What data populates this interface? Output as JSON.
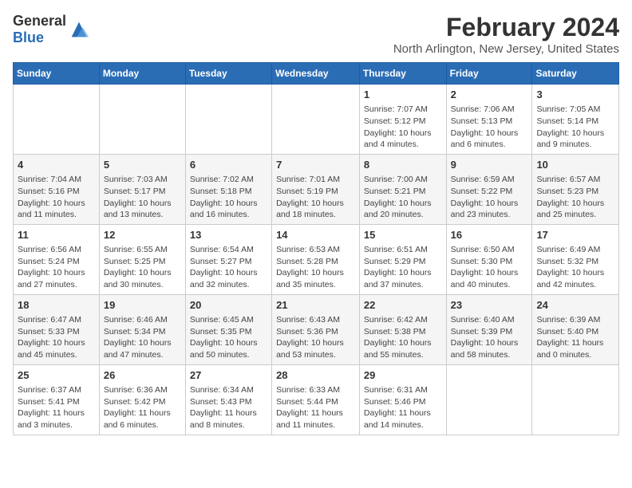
{
  "app": {
    "logo_general": "General",
    "logo_blue": "Blue"
  },
  "header": {
    "title": "February 2024",
    "subtitle": "North Arlington, New Jersey, United States"
  },
  "weekdays": [
    "Sunday",
    "Monday",
    "Tuesday",
    "Wednesday",
    "Thursday",
    "Friday",
    "Saturday"
  ],
  "weeks": [
    [
      {
        "day": "",
        "content": ""
      },
      {
        "day": "",
        "content": ""
      },
      {
        "day": "",
        "content": ""
      },
      {
        "day": "",
        "content": ""
      },
      {
        "day": "1",
        "content": "Sunrise: 7:07 AM\nSunset: 5:12 PM\nDaylight: 10 hours\nand 4 minutes."
      },
      {
        "day": "2",
        "content": "Sunrise: 7:06 AM\nSunset: 5:13 PM\nDaylight: 10 hours\nand 6 minutes."
      },
      {
        "day": "3",
        "content": "Sunrise: 7:05 AM\nSunset: 5:14 PM\nDaylight: 10 hours\nand 9 minutes."
      }
    ],
    [
      {
        "day": "4",
        "content": "Sunrise: 7:04 AM\nSunset: 5:16 PM\nDaylight: 10 hours\nand 11 minutes."
      },
      {
        "day": "5",
        "content": "Sunrise: 7:03 AM\nSunset: 5:17 PM\nDaylight: 10 hours\nand 13 minutes."
      },
      {
        "day": "6",
        "content": "Sunrise: 7:02 AM\nSunset: 5:18 PM\nDaylight: 10 hours\nand 16 minutes."
      },
      {
        "day": "7",
        "content": "Sunrise: 7:01 AM\nSunset: 5:19 PM\nDaylight: 10 hours\nand 18 minutes."
      },
      {
        "day": "8",
        "content": "Sunrise: 7:00 AM\nSunset: 5:21 PM\nDaylight: 10 hours\nand 20 minutes."
      },
      {
        "day": "9",
        "content": "Sunrise: 6:59 AM\nSunset: 5:22 PM\nDaylight: 10 hours\nand 23 minutes."
      },
      {
        "day": "10",
        "content": "Sunrise: 6:57 AM\nSunset: 5:23 PM\nDaylight: 10 hours\nand 25 minutes."
      }
    ],
    [
      {
        "day": "11",
        "content": "Sunrise: 6:56 AM\nSunset: 5:24 PM\nDaylight: 10 hours\nand 27 minutes."
      },
      {
        "day": "12",
        "content": "Sunrise: 6:55 AM\nSunset: 5:25 PM\nDaylight: 10 hours\nand 30 minutes."
      },
      {
        "day": "13",
        "content": "Sunrise: 6:54 AM\nSunset: 5:27 PM\nDaylight: 10 hours\nand 32 minutes."
      },
      {
        "day": "14",
        "content": "Sunrise: 6:53 AM\nSunset: 5:28 PM\nDaylight: 10 hours\nand 35 minutes."
      },
      {
        "day": "15",
        "content": "Sunrise: 6:51 AM\nSunset: 5:29 PM\nDaylight: 10 hours\nand 37 minutes."
      },
      {
        "day": "16",
        "content": "Sunrise: 6:50 AM\nSunset: 5:30 PM\nDaylight: 10 hours\nand 40 minutes."
      },
      {
        "day": "17",
        "content": "Sunrise: 6:49 AM\nSunset: 5:32 PM\nDaylight: 10 hours\nand 42 minutes."
      }
    ],
    [
      {
        "day": "18",
        "content": "Sunrise: 6:47 AM\nSunset: 5:33 PM\nDaylight: 10 hours\nand 45 minutes."
      },
      {
        "day": "19",
        "content": "Sunrise: 6:46 AM\nSunset: 5:34 PM\nDaylight: 10 hours\nand 47 minutes."
      },
      {
        "day": "20",
        "content": "Sunrise: 6:45 AM\nSunset: 5:35 PM\nDaylight: 10 hours\nand 50 minutes."
      },
      {
        "day": "21",
        "content": "Sunrise: 6:43 AM\nSunset: 5:36 PM\nDaylight: 10 hours\nand 53 minutes."
      },
      {
        "day": "22",
        "content": "Sunrise: 6:42 AM\nSunset: 5:38 PM\nDaylight: 10 hours\nand 55 minutes."
      },
      {
        "day": "23",
        "content": "Sunrise: 6:40 AM\nSunset: 5:39 PM\nDaylight: 10 hours\nand 58 minutes."
      },
      {
        "day": "24",
        "content": "Sunrise: 6:39 AM\nSunset: 5:40 PM\nDaylight: 11 hours\nand 0 minutes."
      }
    ],
    [
      {
        "day": "25",
        "content": "Sunrise: 6:37 AM\nSunset: 5:41 PM\nDaylight: 11 hours\nand 3 minutes."
      },
      {
        "day": "26",
        "content": "Sunrise: 6:36 AM\nSunset: 5:42 PM\nDaylight: 11 hours\nand 6 minutes."
      },
      {
        "day": "27",
        "content": "Sunrise: 6:34 AM\nSunset: 5:43 PM\nDaylight: 11 hours\nand 8 minutes."
      },
      {
        "day": "28",
        "content": "Sunrise: 6:33 AM\nSunset: 5:44 PM\nDaylight: 11 hours\nand 11 minutes."
      },
      {
        "day": "29",
        "content": "Sunrise: 6:31 AM\nSunset: 5:46 PM\nDaylight: 11 hours\nand 14 minutes."
      },
      {
        "day": "",
        "content": ""
      },
      {
        "day": "",
        "content": ""
      }
    ]
  ]
}
